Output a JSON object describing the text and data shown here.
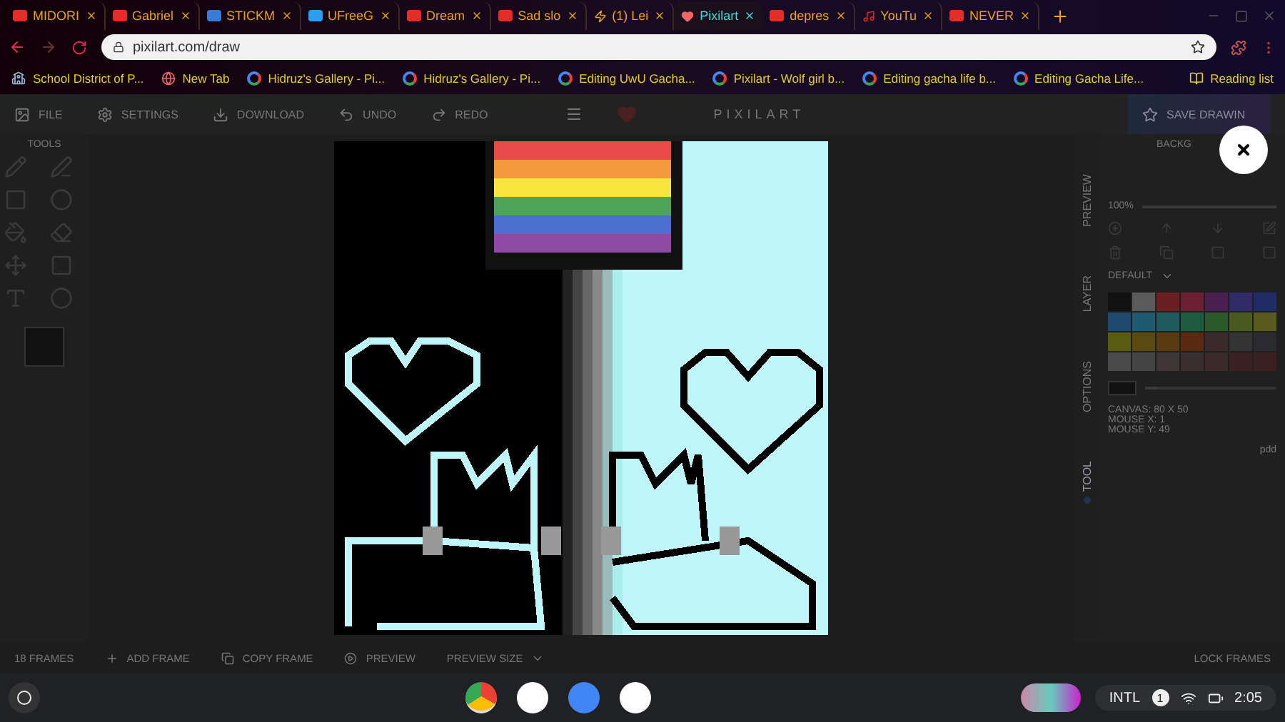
{
  "browser": {
    "tabs": [
      {
        "title": "MIDORI",
        "kind": "video",
        "selected": false
      },
      {
        "title": "Gabriel",
        "kind": "video",
        "selected": false
      },
      {
        "title": "STICKM",
        "kind": "round",
        "selected": false
      },
      {
        "title": "UFreeG",
        "kind": "app",
        "selected": false
      },
      {
        "title": "Dream",
        "kind": "video",
        "selected": false
      },
      {
        "title": "Sad slo",
        "kind": "video",
        "selected": false
      },
      {
        "title": "(1) Lei",
        "kind": "bolt",
        "selected": false
      },
      {
        "title": "Pixilart",
        "kind": "heart",
        "selected": true
      },
      {
        "title": "depres",
        "kind": "video",
        "selected": false
      },
      {
        "title": "YouTu",
        "kind": "music",
        "selected": false
      },
      {
        "title": "NEVER",
        "kind": "video",
        "selected": false
      }
    ],
    "address": "pixilart.com/draw",
    "bookmarks": [
      {
        "title": "School District of P...",
        "kind": "school"
      },
      {
        "title": "New Tab",
        "kind": "globe"
      },
      {
        "title": "Hidruz's Gallery - Pi...",
        "kind": "g"
      },
      {
        "title": "Hidruz's Gallery - Pi...",
        "kind": "g"
      },
      {
        "title": "Editing UwU Gacha...",
        "kind": "g"
      },
      {
        "title": "Pixilart - Wolf girl b...",
        "kind": "g"
      },
      {
        "title": "Editing gacha life b...",
        "kind": "g"
      },
      {
        "title": "Editing Gacha Life...",
        "kind": "g"
      }
    ],
    "reading_list": "Reading list"
  },
  "app": {
    "menu": [
      {
        "label": "FILE",
        "kind": "file"
      },
      {
        "label": "SETTINGS",
        "kind": "settings"
      },
      {
        "label": "DOWNLOAD",
        "kind": "download"
      },
      {
        "label": "UNDO",
        "kind": "undo"
      },
      {
        "label": "REDO",
        "kind": "redo"
      }
    ],
    "brand": "PIXILART",
    "save_button": "SAVE DRAWIN",
    "tools_label": "TOOLS",
    "panel_tabs": [
      {
        "label": "PREVIEW",
        "selected": false
      },
      {
        "label": "LAYER",
        "selected": false
      },
      {
        "label": "OPTIONS",
        "selected": false
      },
      {
        "label": "TOOL",
        "selected": true
      }
    ],
    "layer_name": "BACKG",
    "opacity": {
      "reading": "100%",
      "level": 1
    },
    "palette_name": "DEFAULT",
    "palette": [
      {
        "color": "#111111"
      },
      {
        "color": "#5a5a5a"
      },
      {
        "color": "#6a2020"
      },
      {
        "color": "#6a2030"
      },
      {
        "color": "#4a2050"
      },
      {
        "color": "#302a66"
      },
      {
        "color": "#202c66"
      },
      {
        "color": "#1e4a70"
      },
      {
        "color": "#1e5a70"
      },
      {
        "color": "#1e5a60"
      },
      {
        "color": "#1e5a40"
      },
      {
        "color": "#2a5a2a"
      },
      {
        "color": "#4a5a1e"
      },
      {
        "color": "#5a5a1e"
      },
      {
        "color": "#5a5a10"
      },
      {
        "color": "#5a4a10"
      },
      {
        "color": "#5a3a10"
      },
      {
        "color": "#5a2a10"
      },
      {
        "color": "#3a2a2a"
      },
      {
        "color": "#333333"
      },
      {
        "color": "#2a2a30"
      },
      {
        "color": "#4a4a4a"
      },
      {
        "color": "#444444"
      },
      {
        "color": "#3e3636"
      },
      {
        "color": "#3a2e2e"
      },
      {
        "color": "#3a2a2a"
      },
      {
        "color": "#3a2222"
      },
      {
        "color": "#3a2020"
      }
    ],
    "brush_size": {
      "level": 0.1
    },
    "info": [
      "CANVAS: 80 X 50",
      "MOUSE X: 1",
      "MOUSE Y: 49"
    ],
    "side_label": "pdd",
    "frames_bar": [
      {
        "label": "18 FRAMES",
        "kind": "none"
      },
      {
        "label": "ADD FRAME",
        "kind": "plus"
      },
      {
        "label": "COPY FRAME",
        "kind": "copy"
      },
      {
        "label": "PREVIEW",
        "kind": "play"
      },
      {
        "label": "PREVIEW SIZE",
        "kind": "caret"
      }
    ],
    "lock_frames": "LOCK FRAMES"
  },
  "shelf": {
    "apps": [
      {
        "kind": "chrome",
        "selected": true
      },
      {
        "kind": "app",
        "selected": false
      },
      {
        "kind": "docs",
        "selected": false
      },
      {
        "kind": "mail",
        "selected": false
      }
    ],
    "input_method": "INTL",
    "notifications": "1",
    "time": "2:05"
  }
}
